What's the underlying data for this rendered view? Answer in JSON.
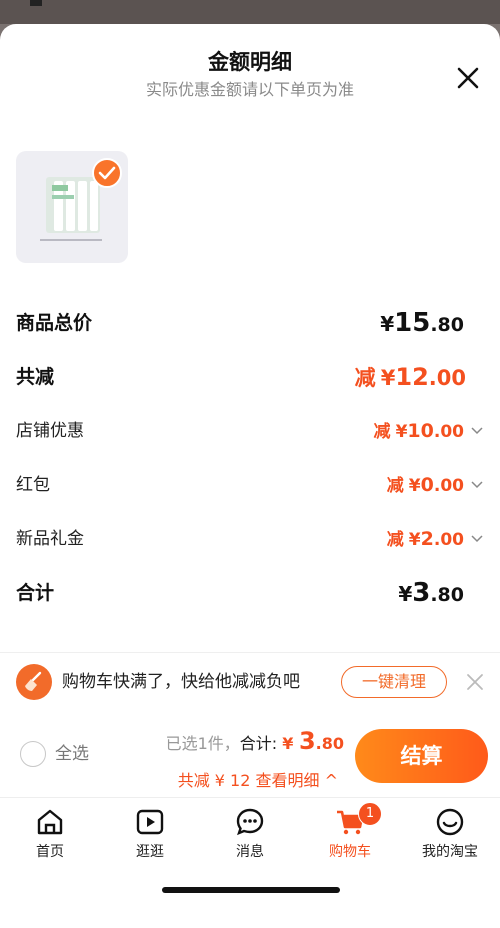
{
  "sheet": {
    "title": "金额明细",
    "subtitle": "实际优惠金额请以下单页为准"
  },
  "product": {
    "selected": true
  },
  "summary": {
    "goods_total": {
      "label": "商品总价",
      "currency": "¥",
      "int": "15",
      "dec": ".80"
    },
    "total_reduced": {
      "label": "共减",
      "prefix": "减",
      "currency": "¥",
      "int": "12",
      "dec": ".00"
    },
    "shop_discount": {
      "label": "店铺优惠",
      "prefix": "减",
      "currency": "¥",
      "int": "10",
      "dec": ".00"
    },
    "red_packet": {
      "label": "红包",
      "prefix": "减",
      "currency": "¥",
      "int": "0",
      "dec": ".00"
    },
    "new_gift": {
      "label": "新品礼金",
      "prefix": "减",
      "currency": "¥",
      "int": "2",
      "dec": ".00"
    },
    "grand_total": {
      "label": "合计",
      "currency": "¥",
      "int": "3",
      "dec": ".80"
    }
  },
  "banner": {
    "text": "购物车快满了，快给他减减负吧",
    "button": "一键清理"
  },
  "checkout": {
    "select_all": "全选",
    "selected_count": "已选1件，",
    "total_label": "合计:",
    "currency": "¥ ",
    "int": "3",
    "dec": ".80",
    "discount_line": "共减 ¥ 12  查看明细 ^",
    "pay_button": "结算"
  },
  "tabs": [
    {
      "label": "首页",
      "icon": "home-icon"
    },
    {
      "label": "逛逛",
      "icon": "play-icon"
    },
    {
      "label": "消息",
      "icon": "chat-icon"
    },
    {
      "label": "购物车",
      "icon": "cart-icon",
      "badge": "1"
    },
    {
      "label": "我的淘宝",
      "icon": "profile-icon"
    }
  ],
  "colors": {
    "accent": "#f4501f",
    "button_gradient_start": "#ff8a1a",
    "button_gradient_end": "#ff5a1a"
  }
}
